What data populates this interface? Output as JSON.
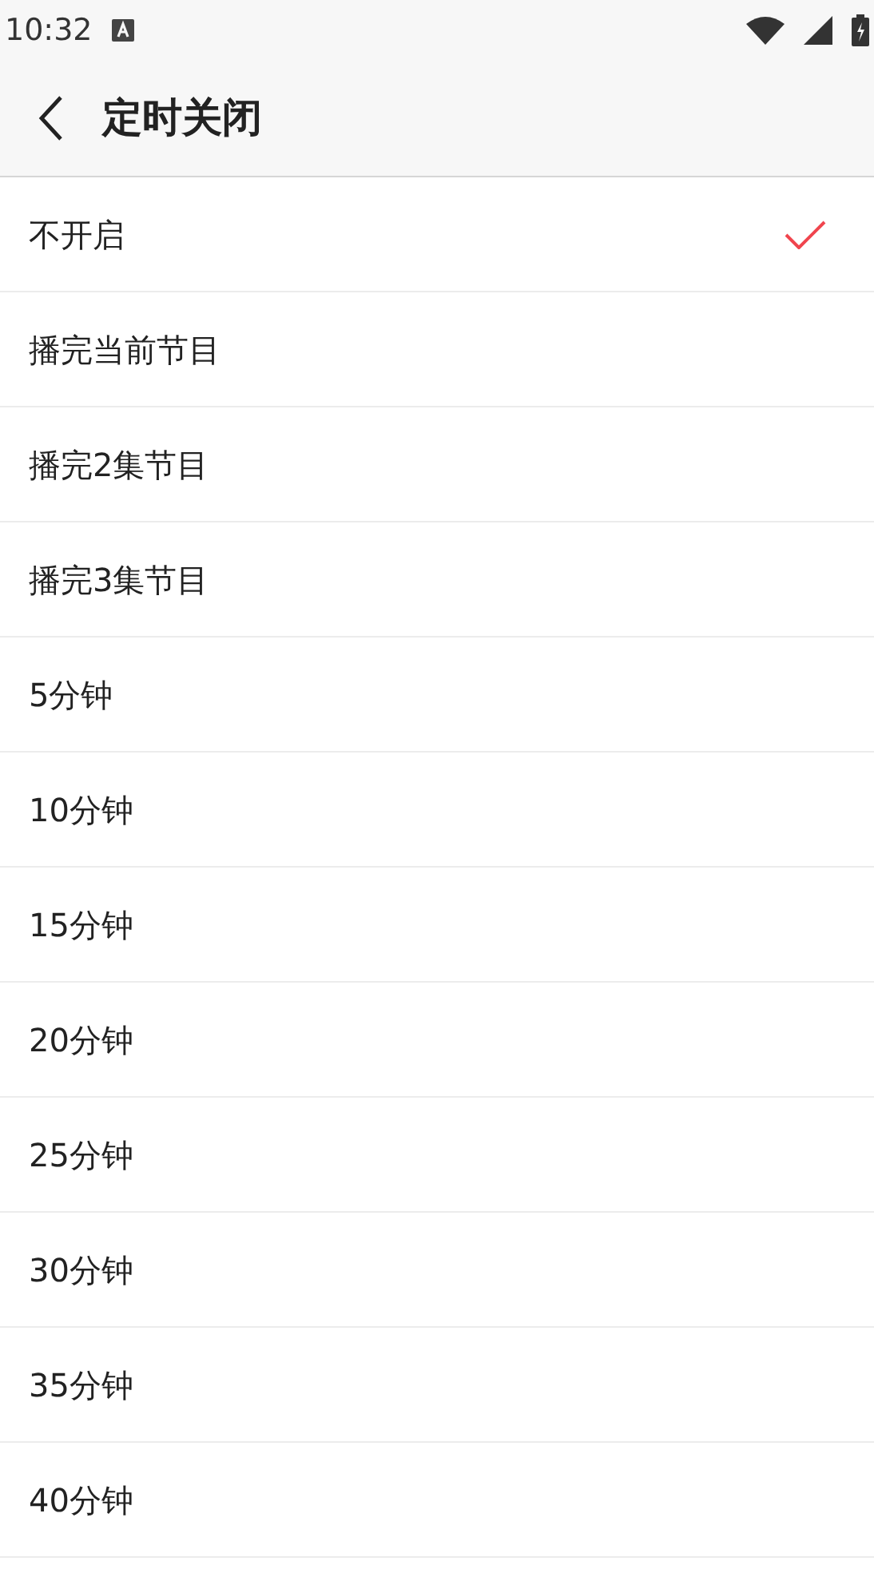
{
  "status_bar": {
    "time": "10:32"
  },
  "header": {
    "title": "定时关闭"
  },
  "options": [
    {
      "label": "不开启",
      "selected": true
    },
    {
      "label": "播完当前节目",
      "selected": false
    },
    {
      "label": "播完2集节目",
      "selected": false
    },
    {
      "label": "播完3集节目",
      "selected": false
    },
    {
      "label": "5分钟",
      "selected": false
    },
    {
      "label": "10分钟",
      "selected": false
    },
    {
      "label": "15分钟",
      "selected": false
    },
    {
      "label": "20分钟",
      "selected": false
    },
    {
      "label": "25分钟",
      "selected": false
    },
    {
      "label": "30分钟",
      "selected": false
    },
    {
      "label": "35分钟",
      "selected": false
    },
    {
      "label": "40分钟",
      "selected": false
    }
  ]
}
